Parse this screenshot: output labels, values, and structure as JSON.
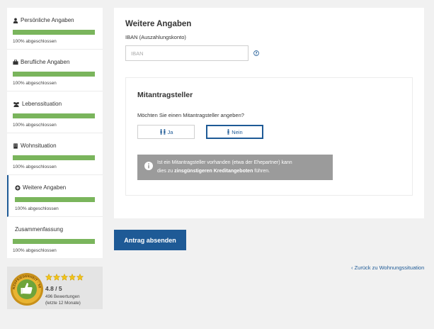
{
  "sidebar": {
    "steps": [
      {
        "title": "Persönliche Angaben",
        "icon": "user-icon",
        "status": "100% abgeschlossen",
        "progress": 1.0
      },
      {
        "title": "Berufliche Angaben",
        "icon": "briefcase-icon",
        "status": "100% abgeschlossen",
        "progress": 1.0
      },
      {
        "title": "Lebenssituation",
        "icon": "users-icon",
        "status": "100% abgeschlossen",
        "progress": 1.0
      },
      {
        "title": "Wohnsituation",
        "icon": "building-icon",
        "status": "100% abgeschlossen",
        "progress": 1.0
      },
      {
        "title": "Weitere Angaben",
        "icon": "plus-circle-icon",
        "status": "100% abgeschlossen",
        "progress": 1.0,
        "active": true
      },
      {
        "title": "Zusammenfassung",
        "icon": "",
        "status": "100% abgeschlossen",
        "progress": 1.0
      }
    ]
  },
  "rating": {
    "seal_text": "KUNDENZUFRIEDENHEIT · SEHR GUT",
    "stars": 5,
    "score": "4.8 / 5",
    "count": "496 Bewertungen",
    "period": "(letzte 12 Monate)"
  },
  "form": {
    "title": "Weitere Angaben",
    "iban_label": "IBAN (Auszahlungskonto)",
    "iban_placeholder": "IBAN",
    "iban_value": "",
    "coapplicant": {
      "title": "Mitantragsteller",
      "question": "Möchten Sie einen Mitantragsteller angeben?",
      "option_yes": "Ja",
      "option_no": "Nein",
      "selected": "Nein",
      "info_line1": "Ist ein Mitantragsteller vorhanden (etwa der Ehepartner) kann",
      "info_line2_prefix": "dies zu ",
      "info_line2_bold": "zinsgünstigeren Kreditangeboten",
      "info_line2_suffix": " führen."
    }
  },
  "actions": {
    "submit_label": "Antrag absenden",
    "back_label": "‹ Zurück zu Wohnungssituation"
  },
  "colors": {
    "primary": "#1e5a96",
    "progress": "#7ab55c",
    "info_bg": "#9b9b9b",
    "page_bg": "#f1f1f1"
  }
}
